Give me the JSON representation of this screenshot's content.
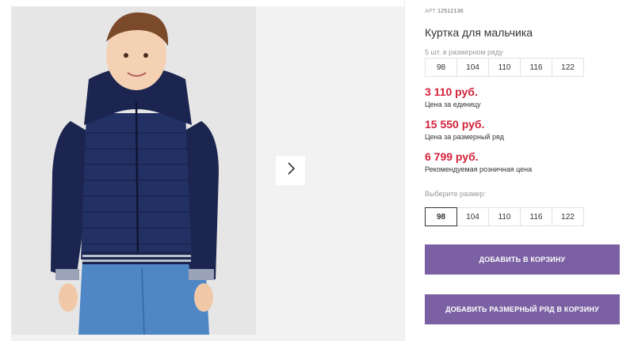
{
  "product": {
    "sku_label": "АРТ",
    "sku_value": "12512136",
    "title": "Куртка для мальчика",
    "pack_note": "5 шт. в размерном ряду",
    "pack_sizes": [
      "98",
      "104",
      "110",
      "116",
      "122"
    ]
  },
  "prices": [
    {
      "value": "3 110 руб.",
      "label": "Цена за единицу"
    },
    {
      "value": "15 550 руб.",
      "label": "Цена за размерный ряд"
    },
    {
      "value": "6 799 руб.",
      "label": "Рекомендуемая розничная цена"
    }
  ],
  "size_picker": {
    "label": "Выберите размер:",
    "options": [
      "98",
      "104",
      "110",
      "116",
      "122"
    ],
    "selected": "98"
  },
  "buttons": {
    "add_to_cart": "ДОБАВИТЬ В КОРЗИНУ",
    "add_pack_to_cart": "ДОБАВИТЬ РАЗМЕРНЫЙ РЯД В КОРЗИНУ"
  },
  "colors": {
    "accent_button": "#7b61a3",
    "price_red": "#d3213a",
    "jacket_navy": "#1f2a55",
    "jeans_blue": "#4f86c6"
  },
  "icons": {
    "next": "chevron-right-icon"
  }
}
